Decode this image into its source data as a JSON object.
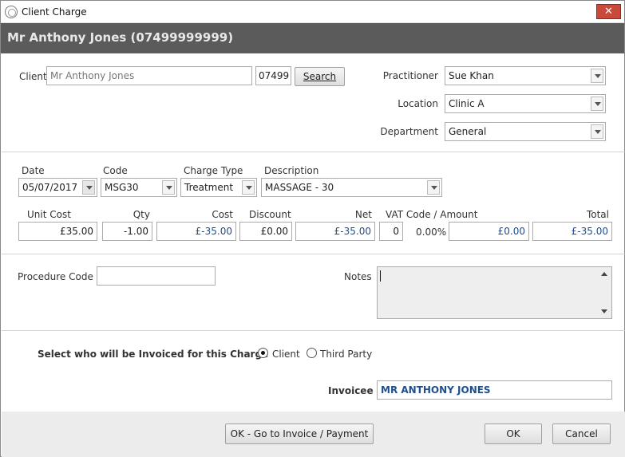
{
  "window": {
    "title": "Client Charge",
    "close_label": "✕",
    "header": "Mr Anthony Jones (07499999999)"
  },
  "client_section": {
    "client_label": "Client",
    "client_value": "Mr Anthony Jones",
    "client_code": "07499",
    "search_label": "Search",
    "practitioner_label": "Practitioner",
    "practitioner_value": "Sue Khan",
    "location_label": "Location",
    "location_value": "Clinic A",
    "department_label": "Department",
    "department_value": "General"
  },
  "charge": {
    "date_label": "Date",
    "date_value": "05/07/2017",
    "code_label": "Code",
    "code_value": "MSG30",
    "charge_type_label": "Charge Type",
    "charge_type_value": "Treatment",
    "description_label": "Description",
    "description_value": "MASSAGE - 30",
    "unit_cost_label": "Unit Cost",
    "unit_cost_value": "£35.00",
    "qty_label": "Qty",
    "qty_value": "-1.00",
    "cost_label": "Cost",
    "cost_value": "£-35.00",
    "discount_label": "Discount",
    "discount_value": "£0.00",
    "net_label": "Net",
    "net_value": "£-35.00",
    "vat_label": "VAT Code / Amount",
    "vat_code_value": "0",
    "vat_rate": "0.00%",
    "vat_amount_value": "£0.00",
    "total_label": "Total",
    "total_value": "£-35.00"
  },
  "extra": {
    "procedure_code_label": "Procedure Code",
    "procedure_code_value": "",
    "notes_label": "Notes",
    "notes_value": ""
  },
  "invoicing": {
    "prompt": "Select who will be Invoiced for this Charge",
    "option_client": "Client",
    "option_third_party": "Third Party",
    "selected": "Client",
    "invoicee_label": "Invoicee",
    "invoicee_value": "MR ANTHONY JONES"
  },
  "footer": {
    "go_to_invoice_label": "OK - Go to Invoice / Payment",
    "ok_label": "OK",
    "cancel_label": "Cancel"
  }
}
